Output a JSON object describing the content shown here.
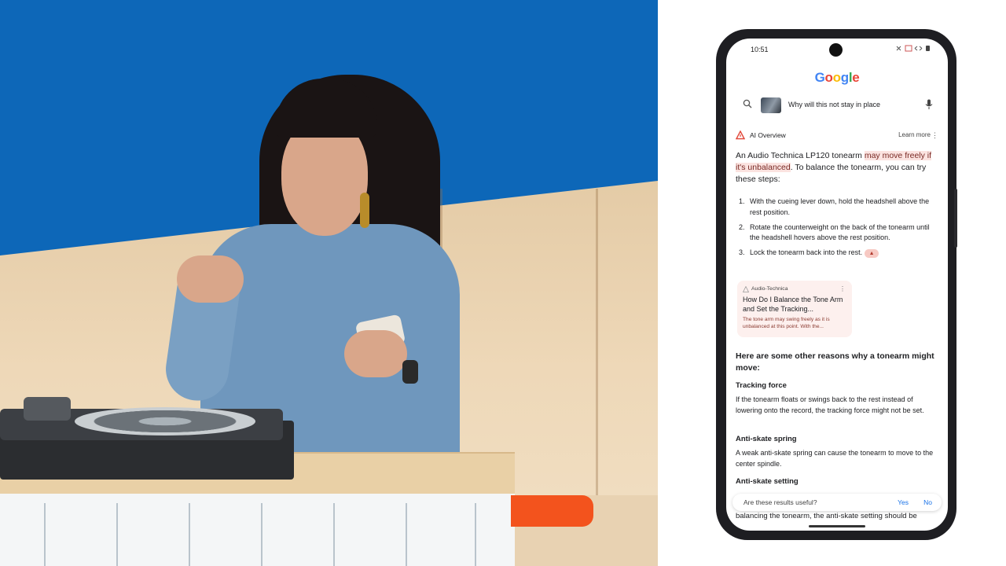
{
  "phone": {
    "status_time": "10:51",
    "logo": {
      "g": "G",
      "o1": "o",
      "o2": "o",
      "g2": "g",
      "l": "l",
      "e": "e"
    },
    "search": {
      "query": "Why will this not stay in place"
    },
    "ai_overview": {
      "label": "AI Overview",
      "learn_more": "Learn more",
      "intro_before": "An Audio Technica LP120 tonearm ",
      "intro_highlight": "may move freely if it's unbalanced",
      "intro_after": ". To balance the tonearm, you can try these steps:",
      "steps": [
        {
          "num": "1.",
          "text": "With the cueing lever down, hold the headshell above the rest position."
        },
        {
          "num": "2.",
          "text": "Rotate the counterweight on the back of the tonearm until the headshell hovers above the rest position."
        },
        {
          "num": "3.",
          "text": "Lock the tonearm back into the rest."
        }
      ],
      "source": {
        "site": "Audio-Technica",
        "title": "How Do I Balance the Tone Arm and Set the Tracking...",
        "snippet": "The tone arm may swing freely as it is unbalanced at this point. With the..."
      },
      "reasons_heading": "Here are some other reasons why a tonearm might move:",
      "reasons": [
        {
          "title": "Tracking force",
          "text": "If the tonearm floats or swings back to the rest instead of lowering onto the record, the tracking force might not be set."
        },
        {
          "title": "Anti-skate spring",
          "text": "A weak anti-skate spring can cause the tonearm to move to the center spindle."
        },
        {
          "title": "Anti-skate setting",
          "text": ""
        }
      ],
      "cutoff_text": "balancing the tonearm, the anti-skate setting should be"
    },
    "feedback": {
      "question": "Are these results useful?",
      "yes": "Yes",
      "no": "No"
    }
  },
  "colors": {
    "google_blue": "#4285f4",
    "google_red": "#ea4335",
    "google_yellow": "#fbbc05",
    "google_green": "#34a853",
    "highlight_bg": "#fbe3e0",
    "link_blue": "#1a73e8",
    "stage_blue": "#0d67b8",
    "accent_orange": "#f3531d"
  }
}
